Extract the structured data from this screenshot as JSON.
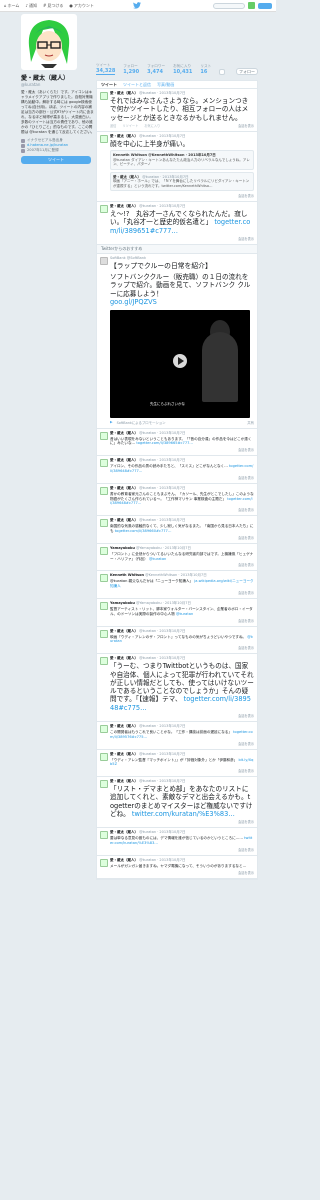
{
  "nav": {
    "home": "ホーム",
    "notifications": "通知",
    "discover": "見つける",
    "me": "アカウント"
  },
  "profile": {
    "name": "愛・蔵太（蔵人）",
    "handle": "@kuratan",
    "bio": "愛・蔵太（あいくらた）です。アイコンはキャラメイクアプリで作りました。自殺対策機構も始動中。解析する時には google検索使ってね(自分用)。ほぼ、ツイートの内容の補足は当方の部分・公式RTがツイート内に含まれ、なるほど納得が高まるし、大変面白い。多数のツイートは当方の責任であり、他の誰かの「ひとりごと」的なものです。ここの問題は @kuratan を通じて反応してください。",
    "location": "イナクセビアル島出身",
    "website": "d.hatena.ne.jp/kuratan",
    "joined": "2007年11月に登録",
    "tweet_to": "ツイート"
  },
  "stats": [
    {
      "label": "ツイート",
      "value": "34,328"
    },
    {
      "label": "フォロー",
      "value": "1,290"
    },
    {
      "label": "フォロワー",
      "value": "3,474"
    },
    {
      "label": "お気に入り",
      "value": "10,431"
    },
    {
      "label": "リスト",
      "value": "16"
    }
  ],
  "follow_label": "フォロー",
  "tabs": {
    "tweets": "ツイート",
    "with_replies": "ツイートと返信",
    "media": "写真/動画"
  },
  "tweets": [
    {
      "name": "愛・蔵太（蔵人）",
      "meta": "@kuratan · 2013年10月7日",
      "text": "それではみなさんさようなら。メンションつきで何かツイートしたり、相互フォローの人はメッセージとか送るときなるかもしれません。",
      "big": true,
      "actions": [
        "返信",
        "リツイート",
        "お気に入り"
      ],
      "more": "会話を表示"
    },
    {
      "name": "愛・蔵太（蔵人）",
      "meta": "@kuratan · 2013年10月7日",
      "text": "顔を中心に上半身が痛い。",
      "big": true,
      "sub": {
        "name": "Kenneth Whitson @KennethWhitson · 2013年10月7日",
        "text": "@kuratan ダイアン・キートンあんなたたん政治人力のリベラルなんでしょうね。アレン、ピーティ、パターノ"
      },
      "reply": {
        "name": "愛・蔵太（蔵人）",
        "meta": "@kuratan · 2013年10月7日",
        "text": "映画『アニー・ホール』では、「ＮＹを舞台にしたリベラルにリビダイアン・キートンが重視する」という流れです。twitter.com/KennethWhitso…"
      },
      "more": "会話を表示"
    },
    {
      "name": "愛・蔵太（蔵人）",
      "meta": "@kuratan · 2013年10月7日",
      "text": "え～!?　丸谷才一さんでくなられたんだ。寂しい。「丸谷才一と歴史的仮名遣と」",
      "link": "togetter.com/li/389651#c777…",
      "big": true,
      "more": "会話を表示"
    }
  ],
  "recommend": {
    "header": "Twitterからのおすすめ",
    "account": "SoftBank @SoftBank",
    "title": "【ラップでクルーの日常を紹介】",
    "desc": "ソフトバンククルー（販売職）の１日の流れをラップで紹介。動画を見て、ソフトバンク クルーに応募しよう！",
    "link": "goo.gl/JPQZVS",
    "caption": "先生にらぶれさいかな",
    "sponsor": "SoftBankによるプロモーション",
    "share": "共有"
  },
  "tweets2": [
    {
      "name": "愛・蔵太（蔵人）",
      "meta": "@kuratan · 2013年10月7日",
      "text": "昔はいい表現をみないということもあります。「「昔の自分達」の作品を今はどこか遠くに」みたいな…",
      "link": "togetter.com/li/389665#c777…"
    },
    {
      "name": "愛・蔵太（蔵人）",
      "meta": "@kuratan · 2013年10月7日",
      "text": "アイロン、その作品の男の読み手たちと、「スミス」どこがなんとなく…",
      "link": "togetter.com/li/389648#c777…"
    },
    {
      "name": "愛・蔵太（蔵人）",
      "meta": "@kuratan · 2013年10月7日",
      "text": "書かの教育者家元さんのこともまぶそん、「カソール、先生がとこでしたし」このような物語がたくさん作られている〜。「工作神マリサン 事業検査の主題だ」",
      "link": "togetter.com/li/389648#c777…"
    },
    {
      "name": "愛・蔵太（蔵人）",
      "meta": "@kuratan · 2013年10月7日",
      "text": "南国的な気風の感触的なくて、少し寂しく気がなるまた。「南国から見る日本人たち」にも",
      "link": "togetter.com/li/389660#c777…"
    },
    {
      "name": "Yamayaboku",
      "meta": "@Yamayaboku · 2013年10月7日",
      "text": "「フロント」に全然からついてるいいたんなる研究者内部ではです。上機嫌風「ヒュゲナー・ハリファ」（作品）",
      "link": "@kuratan"
    },
    {
      "name": "Kenneth Whitson",
      "meta": "@KennethWhitson · 2013年10月7日",
      "text": "@kuratan 親父なんだかは「ニューヨーク知識人」",
      "link": "ja.wikipedia.org/wiki/ニューヨーク知識人"
    },
    {
      "name": "Yamayaboku",
      "meta": "@Yamayaboku · 2013年10月7日",
      "text": "監督アーティスト・リット、脚本家ウォルター・バーンスタイン、企業者のポロ・イータル、のドーソンは実際の製作の中心人物",
      "link": "@kuratan"
    },
    {
      "name": "愛・蔵太（蔵人）",
      "meta": "@kuratan · 2013年10月7日",
      "text": "映画『ウディ・アレンのザ・フロント』ってなものの気がちょうどいいやつですね。",
      "link": "@kuratan"
    },
    {
      "name": "愛・蔵太（蔵人）",
      "meta": "@kuratan · 2013年10月7日",
      "text": "「うーむ、つまりTwittbotというものは、国家や自治体、個人によって犯罪が行われていてそれが正しい情報だとしても、使ってはいけないツールであるということなのでしょうか」そんの疑問です。「【速報】テマ、",
      "link": "togetter.com/li/389548#c775…",
      "big": true
    },
    {
      "name": "愛・蔵太（蔵人）",
      "meta": "@kuratan · 2013年10月7日",
      "text": "この開発者はもうこれで良いことかな。「工作・講談は誌面の遅延になる」",
      "link": "togetter.com/li/389576#c775…"
    },
    {
      "name": "愛・蔵太（蔵人）",
      "meta": "@kuratan · 2013年10月7日",
      "text": "「ウディ・アレン監督『マッチポイント』」が「評価対象外」とか「伊藤和彦」",
      "link": "bit.ly/Xqb5Z"
    },
    {
      "name": "愛・蔵太（蔵人）",
      "meta": "@kuratan · 2013年10月7日",
      "text": "「リスト・デマまとめ部」をあなたのリストに追加してくれと、素敵なデマと出会えるかも。togetterのまとめマイスターほど権威ないですけどね。",
      "link": "twitter.com/kuratan/%E3%83…",
      "big": true
    },
    {
      "name": "愛・蔵太（蔵人）",
      "meta": "@kuratan · 2013年10月7日",
      "text": "要は単なる意見の誰ものには、デマ情報を誰が信じているのかというところに……",
      "link": "twitter.com/kuratan/%E3%83…"
    },
    {
      "name": "愛・蔵太（蔵人）",
      "meta": "@kuratan · 2013年10月7日",
      "text": "メールがガンガン届きますね。ヤマダ電機になって、そういうのがありまするなと…",
      "link": ""
    }
  ],
  "act_labels": {
    "reply": "返信",
    "retweet": "リツイート",
    "fav": "お気に入り",
    "more": "もっと見る",
    "conversation": "会話を表示"
  }
}
